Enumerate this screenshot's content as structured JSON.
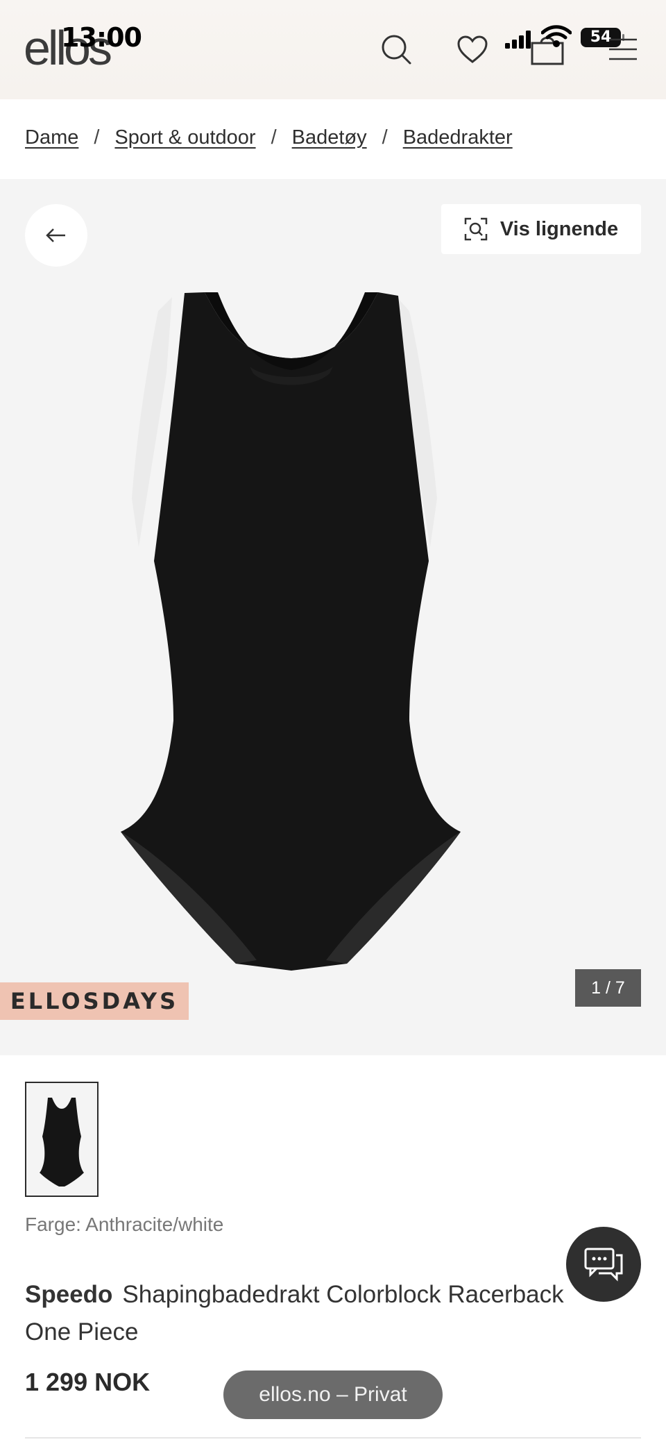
{
  "status_bar": {
    "time": "13:00",
    "battery": "54"
  },
  "header": {
    "logo": "ellos",
    "icons": [
      "search-icon",
      "heart-icon",
      "bag-icon",
      "menu-icon"
    ]
  },
  "breadcrumb": [
    "Dame",
    "Sport & outdoor",
    "Badetøy",
    "Badedrakter"
  ],
  "gallery": {
    "similar_label": "Vis lignende",
    "promo_label": "ELLOSDAYS",
    "counter": "1 / 7"
  },
  "product": {
    "color_label": "Farge: Anthracite/white",
    "brand": "Speedo",
    "name": "Shapingbadedrakt Colorblock Racerback One Piece",
    "price": "1 299 NOK"
  },
  "browser": {
    "url_label": "ellos.no – Privat"
  },
  "colors": {
    "promo": "#efc3b2",
    "swimsuit": "#151515"
  }
}
